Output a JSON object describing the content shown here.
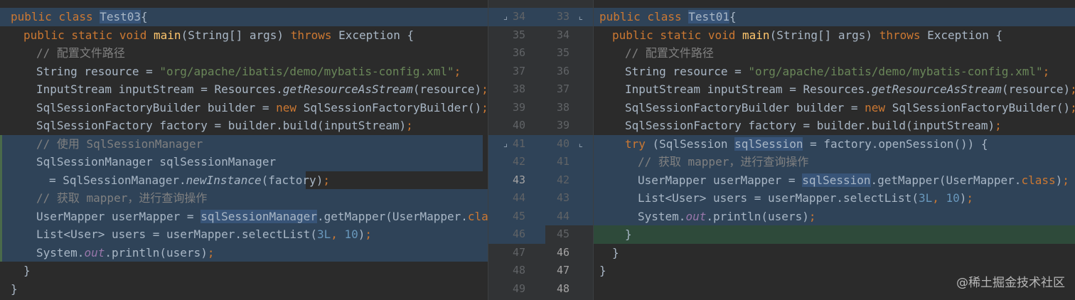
{
  "left": {
    "lines": [
      {
        "ind": 0,
        "parts": [
          [
            "kw",
            "public class "
          ],
          [
            "sel",
            "Test03"
          ],
          [
            "",
            "{"
          ]
        ]
      },
      {
        "ind": 1,
        "parts": [
          [
            "kw",
            "public static void "
          ],
          [
            "fn",
            "main"
          ],
          [
            "",
            "(String[] args) "
          ],
          [
            "kw",
            "throws "
          ],
          [
            "",
            "Exception {"
          ]
        ]
      },
      {
        "ind": 2,
        "parts": [
          [
            "cm",
            "// 配置文件路径"
          ]
        ]
      },
      {
        "ind": 2,
        "parts": [
          [
            "",
            "String resource = "
          ],
          [
            "str",
            "\"org/apache/ibatis/demo/mybatis-config.xml\""
          ],
          [
            "kw",
            ";"
          ]
        ]
      },
      {
        "ind": 2,
        "parts": [
          [
            "",
            "InputStream inputStream = Resources."
          ],
          [
            "it",
            "getResourceAsStream"
          ],
          [
            "",
            "(resource)"
          ],
          [
            "kw",
            ";"
          ]
        ]
      },
      {
        "ind": 2,
        "parts": [
          [
            "",
            "SqlSessionFactoryBuilder builder = "
          ],
          [
            "kw",
            "new "
          ],
          [
            "",
            "SqlSessionFactoryBuilder()"
          ],
          [
            "kw",
            ";"
          ]
        ]
      },
      {
        "ind": 2,
        "parts": [
          [
            "",
            "SqlSessionFactory factory = builder.build(inputStream)"
          ],
          [
            "kw",
            ";"
          ]
        ]
      },
      {
        "ind": 2,
        "parts": [
          [
            "cm",
            "// 使用 SqlSessionManager"
          ]
        ]
      },
      {
        "ind": 2,
        "parts": [
          [
            "",
            "SqlSessionManager sqlSessionManager"
          ]
        ]
      },
      {
        "ind": 3,
        "parts": [
          [
            "",
            "= SqlSessionManager."
          ],
          [
            "it",
            "newInstance"
          ],
          [
            "",
            "(factory)"
          ],
          [
            "kw",
            ";"
          ]
        ]
      },
      {
        "ind": 2,
        "parts": [
          [
            "cm",
            "// 获取 mapper，进行查询操作"
          ]
        ]
      },
      {
        "ind": 2,
        "parts": [
          [
            "",
            "UserMapper userMapper = "
          ],
          [
            "sel",
            "sqlSessionManager"
          ],
          [
            "",
            ".getMapper(UserMapper."
          ],
          [
            "kw",
            "class"
          ],
          [
            "",
            ")"
          ],
          [
            "kw",
            ";"
          ]
        ]
      },
      {
        "ind": 2,
        "parts": [
          [
            "",
            "List<User> users = userMapper.selectList("
          ],
          [
            "num",
            "3L"
          ],
          [
            "kw",
            ", "
          ],
          [
            "num",
            "10"
          ],
          [
            "",
            ")"
          ],
          [
            "kw",
            ";"
          ]
        ]
      },
      {
        "ind": 2,
        "parts": [
          [
            "",
            "System."
          ],
          [
            "fld",
            "out"
          ],
          [
            "",
            ".println(users)"
          ],
          [
            "kw",
            ";"
          ]
        ]
      },
      {
        "ind": 1,
        "parts": [
          [
            "",
            "}"
          ]
        ]
      },
      {
        "ind": 0,
        "parts": [
          [
            "",
            "}"
          ]
        ]
      }
    ]
  },
  "gutter": {
    "left_nums": [
      "34",
      "35",
      "36",
      "37",
      "38",
      "39",
      "40",
      "41",
      "42",
      "43",
      "44",
      "45",
      "46",
      "47",
      "48",
      "49"
    ],
    "right_nums": [
      "33",
      "34",
      "35",
      "36",
      "37",
      "38",
      "39",
      "40",
      "41",
      "42",
      "43",
      "44",
      "45",
      "46",
      "47",
      "48"
    ]
  },
  "right": {
    "lines": [
      {
        "ind": 0,
        "parts": [
          [
            "kw",
            "public class "
          ],
          [
            "sel",
            "Test01"
          ],
          [
            "",
            "{"
          ]
        ]
      },
      {
        "ind": 1,
        "parts": [
          [
            "kw",
            "public static void "
          ],
          [
            "fn",
            "main"
          ],
          [
            "",
            "(String[] args) "
          ],
          [
            "kw",
            "throws "
          ],
          [
            "",
            "Exception {"
          ]
        ]
      },
      {
        "ind": 2,
        "parts": [
          [
            "cm",
            "// 配置文件路径"
          ]
        ]
      },
      {
        "ind": 2,
        "parts": [
          [
            "",
            "String resource = "
          ],
          [
            "str",
            "\"org/apache/ibatis/demo/mybatis-config.xml\""
          ],
          [
            "kw",
            ";"
          ]
        ]
      },
      {
        "ind": 2,
        "parts": [
          [
            "",
            "InputStream inputStream = Resources."
          ],
          [
            "it",
            "getResourceAsStream"
          ],
          [
            "",
            "(resource)"
          ],
          [
            "kw",
            ";"
          ]
        ]
      },
      {
        "ind": 2,
        "parts": [
          [
            "",
            "SqlSessionFactoryBuilder builder = "
          ],
          [
            "kw",
            "new "
          ],
          [
            "",
            "SqlSessionFactoryBuilder()"
          ],
          [
            "kw",
            ";"
          ]
        ]
      },
      {
        "ind": 2,
        "parts": [
          [
            "",
            "SqlSessionFactory factory = builder.build(inputStream)"
          ],
          [
            "kw",
            ";"
          ]
        ]
      },
      {
        "ind": 2,
        "parts": [
          [
            "kw",
            "try "
          ],
          [
            "",
            "(SqlSession "
          ],
          [
            "sel",
            "sqlSession"
          ],
          [
            "",
            " = factory.openSession()) {"
          ]
        ]
      },
      {
        "ind": 3,
        "parts": [
          [
            "cm",
            "// 获取 mapper，进行查询操作"
          ]
        ]
      },
      {
        "ind": 3,
        "parts": [
          [
            "",
            "UserMapper userMapper = "
          ],
          [
            "sel",
            "sqlSession"
          ],
          [
            "",
            ".getMapper(UserMapper."
          ],
          [
            "kw",
            "class"
          ],
          [
            "",
            ")"
          ],
          [
            "kw",
            ";"
          ]
        ]
      },
      {
        "ind": 3,
        "parts": [
          [
            "",
            "List<User> users = userMapper.selectList("
          ],
          [
            "num",
            "3L"
          ],
          [
            "kw",
            ", "
          ],
          [
            "num",
            "10"
          ],
          [
            "",
            ")"
          ],
          [
            "kw",
            ";"
          ]
        ]
      },
      {
        "ind": 3,
        "parts": [
          [
            "",
            "System."
          ],
          [
            "fld",
            "out"
          ],
          [
            "",
            ".println(users)"
          ],
          [
            "kw",
            ";"
          ]
        ]
      },
      {
        "ind": 2,
        "parts": [
          [
            "",
            "}"
          ]
        ]
      },
      {
        "ind": 1,
        "parts": [
          [
            "",
            "}"
          ]
        ]
      },
      {
        "ind": 0,
        "parts": [
          [
            "",
            "}"
          ]
        ]
      }
    ]
  },
  "watermark": "@稀土掘金技术社区"
}
